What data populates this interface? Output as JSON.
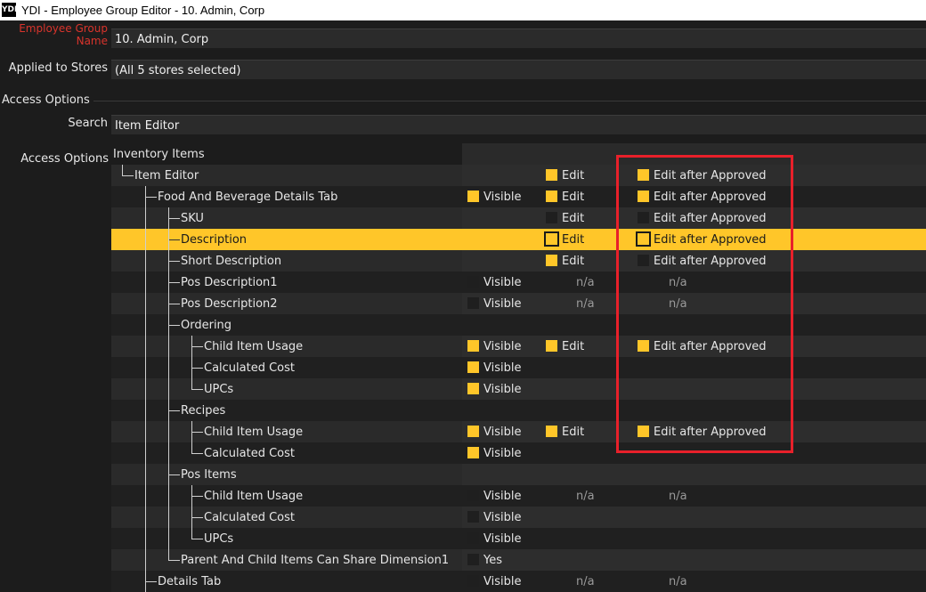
{
  "window": {
    "app_icon": "YDI",
    "title": "YDI - Employee Group Editor - 10. Admin, Corp"
  },
  "form": {
    "group_name_label_line1": "Employee Group",
    "group_name_label_line2": "Name",
    "group_name_value": "10. Admin, Corp",
    "stores_label": "Applied to Stores",
    "stores_value": "(All 5 stores selected)",
    "section_title": "Access Options",
    "search_label": "Search",
    "search_value": "Item Editor",
    "access_options_label": "Access Options"
  },
  "tree": [
    {
      "level": 0,
      "name": "Inventory Items"
    },
    {
      "level": 1,
      "name": "Item Editor",
      "edit": {
        "label": "Edit",
        "checked": true
      },
      "approved": {
        "label": "Edit after Approved",
        "checked": true
      }
    },
    {
      "level": 2,
      "name": "Food And Beverage Details Tab",
      "visible": {
        "label": "Visible",
        "checked": true
      },
      "edit": {
        "label": "Edit",
        "checked": true
      },
      "approved": {
        "label": "Edit after Approved",
        "checked": true
      }
    },
    {
      "level": 3,
      "name": "SKU",
      "edit": {
        "label": "Edit",
        "checked": false
      },
      "approved": {
        "label": "Edit after Approved",
        "checked": false
      }
    },
    {
      "level": 3,
      "name": "Description",
      "selected": true,
      "edit": {
        "label": "Edit",
        "checked": true,
        "focus": true
      },
      "approved": {
        "label": "Edit after Approved",
        "checked": true,
        "focus": true
      }
    },
    {
      "level": 3,
      "name": "Short Description",
      "edit": {
        "label": "Edit",
        "checked": true
      },
      "approved": {
        "label": "Edit after Approved",
        "checked": false
      }
    },
    {
      "level": 3,
      "name": "Pos Description1",
      "visible": {
        "label": "Visible",
        "checked": false
      },
      "edit_na": "n/a",
      "approved_na": "n/a"
    },
    {
      "level": 3,
      "name": "Pos Description2",
      "visible": {
        "label": "Visible",
        "checked": false
      },
      "edit_na": "n/a",
      "approved_na": "n/a"
    },
    {
      "level": 3,
      "name": "Ordering"
    },
    {
      "level": 4,
      "name": "Child Item Usage",
      "visible": {
        "label": "Visible",
        "checked": true
      },
      "edit": {
        "label": "Edit",
        "checked": true
      },
      "approved": {
        "label": "Edit after Approved",
        "checked": true
      }
    },
    {
      "level": 4,
      "name": "Calculated Cost",
      "visible": {
        "label": "Visible",
        "checked": true
      }
    },
    {
      "level": 4,
      "name": "UPCs",
      "visible": {
        "label": "Visible",
        "checked": true
      }
    },
    {
      "level": 3,
      "name": "Recipes"
    },
    {
      "level": 4,
      "name": "Child Item Usage",
      "visible": {
        "label": "Visible",
        "checked": true
      },
      "edit": {
        "label": "Edit",
        "checked": true
      },
      "approved": {
        "label": "Edit after Approved",
        "checked": true
      }
    },
    {
      "level": 4,
      "name": "Calculated Cost",
      "visible": {
        "label": "Visible",
        "checked": true
      }
    },
    {
      "level": 3,
      "name": "Pos Items"
    },
    {
      "level": 4,
      "name": "Child Item Usage",
      "visible": {
        "label": "Visible",
        "checked": false
      },
      "edit_na": "n/a",
      "approved_na": "n/a"
    },
    {
      "level": 4,
      "name": "Calculated Cost",
      "visible": {
        "label": "Visible",
        "checked": false
      }
    },
    {
      "level": 4,
      "name": "UPCs",
      "visible": {
        "label": "Visible",
        "checked": false
      }
    },
    {
      "level": 3,
      "name": "Parent And Child Items Can Share Dimension1",
      "visible": {
        "label": "Yes",
        "checked": false
      }
    },
    {
      "level": 2,
      "name": "Details Tab",
      "visible": {
        "label": "Visible",
        "checked": false
      },
      "edit_na": "n/a",
      "approved_na": "n/a"
    }
  ],
  "colors": {
    "accent": "#ffc629",
    "highlight_box": "#e8202a",
    "required_label": "#d9342c",
    "background": "#1c1c1c"
  }
}
